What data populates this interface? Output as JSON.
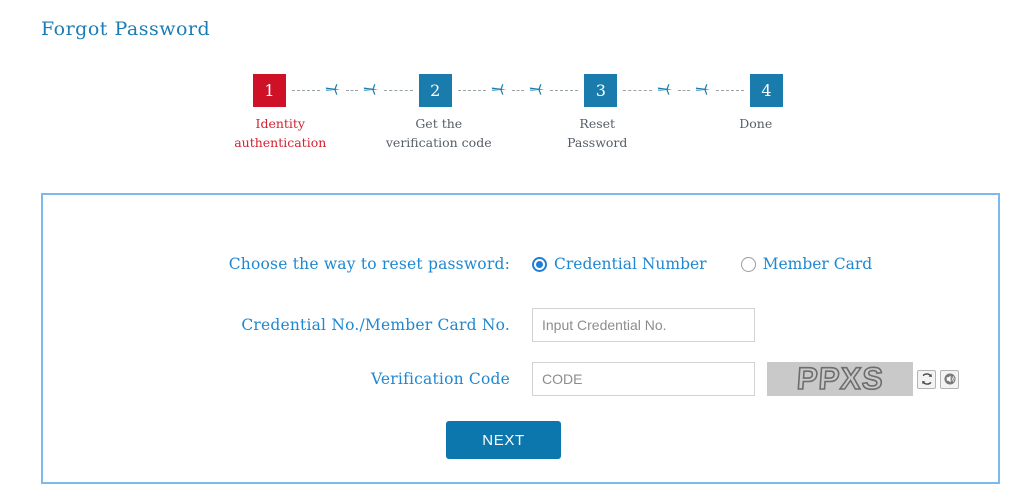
{
  "page": {
    "title": "Forgot Password",
    "title_color": "#1a7cb5"
  },
  "stepper": {
    "connector_icon": "airplane-icon",
    "colors": {
      "current": "#ce1126",
      "upcoming": "#1a7cac",
      "active_label": "#d32231",
      "inactive_label": "#555e66",
      "dash": "#9aa3a8"
    },
    "steps": [
      {
        "number": "1",
        "label": "Identity\nauthentication",
        "state": "current"
      },
      {
        "number": "2",
        "label": "Get the\nverification code",
        "state": "upcoming"
      },
      {
        "number": "3",
        "label": "Reset\nPassword",
        "state": "upcoming"
      },
      {
        "number": "4",
        "label": "Done",
        "state": "upcoming"
      }
    ]
  },
  "form": {
    "border_color": "#7cb9ef",
    "label_color": "#2088d0",
    "method": {
      "label": "Choose the way to reset password:",
      "options": [
        {
          "label": "Credential Number",
          "selected": true
        },
        {
          "label": "Member Card",
          "selected": false
        }
      ]
    },
    "credential": {
      "label": "Credential No./Member Card No.",
      "value": "",
      "placeholder": "Input Credential No."
    },
    "verification": {
      "label": "Verification Code",
      "value": "",
      "placeholder": "CODE",
      "captcha_text": "PPXS",
      "refresh_icon": "refresh-icon",
      "audio_icon": "speaker-icon"
    },
    "next_button": {
      "label": "NEXT",
      "color": "#0b77ad"
    }
  }
}
